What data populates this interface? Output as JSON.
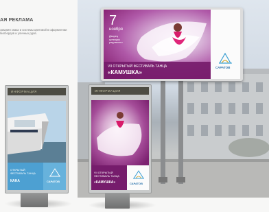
{
  "panel": {
    "heading": "АЯ РЕКЛАМА",
    "description": "зования знака и системы цветовой в оформлении билбордов и уличных рдов."
  },
  "billboard": {
    "date_day": "7",
    "date_month": "ноября",
    "venue": "Дворец культуры рядовского",
    "festival_line1": "VII ОТКРЫТЫЙ ФЕСТИВАЛЬ ТАНЦА",
    "festival_name": "«КАМУШКА»",
    "logo_text": "САРАТОВ"
  },
  "lightbox_left": {
    "header": "ИНФОРМАЦИЯ",
    "caption": "ОТКРЫТЫЙ ФЕСТИВАЛЬ ТАНЦА",
    "caption2": "КАНА",
    "logo_text": "САРАТОВ"
  },
  "lightbox_right": {
    "header": "ИНФОРМАЦИЯ",
    "festival_line1": "VII ОТКРЫТЫЙ ФЕСТИВАЛЬ ТАНЦА",
    "festival_name": "«КАМУШКА»",
    "logo_text": "САРАТОВ"
  },
  "colors": {
    "purple": "#761c6c",
    "sky_blue": "#4da0d2",
    "lightbox_header": "#4d4c43"
  }
}
